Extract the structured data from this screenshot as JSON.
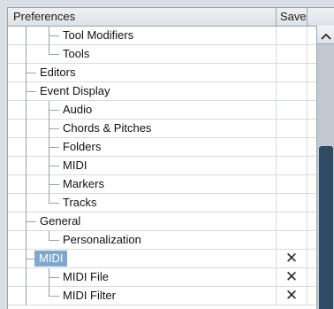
{
  "header": {
    "preferences_label": "Preferences",
    "save_label": "Save"
  },
  "scrollbar": {
    "up_arrow_icon": "chevron-up-icon"
  },
  "rows": [
    {
      "label": "Tool Modifiers",
      "level": 2,
      "saved": false
    },
    {
      "label": "Tools",
      "level": 2,
      "saved": false
    },
    {
      "label": "Editors",
      "level": 1,
      "saved": false
    },
    {
      "label": "Event Display",
      "level": 1,
      "saved": false
    },
    {
      "label": "Audio",
      "level": 2,
      "saved": false
    },
    {
      "label": "Chords & Pitches",
      "level": 2,
      "saved": false
    },
    {
      "label": "Folders",
      "level": 2,
      "saved": false
    },
    {
      "label": "MIDI",
      "level": 2,
      "saved": false
    },
    {
      "label": "Markers",
      "level": 2,
      "saved": false
    },
    {
      "label": "Tracks",
      "level": 2,
      "saved": false
    },
    {
      "label": "General",
      "level": 1,
      "saved": false
    },
    {
      "label": "Personalization",
      "level": 2,
      "saved": false
    },
    {
      "label": "MIDI",
      "level": 1,
      "saved": true,
      "selected": true
    },
    {
      "label": "MIDI File",
      "level": 2,
      "saved": true
    },
    {
      "label": "MIDI Filter",
      "level": 2,
      "saved": true
    }
  ],
  "save_mark": "✕",
  "colors": {
    "selection": "#7fa7d0",
    "scroll_thumb": "#2f4a63"
  }
}
